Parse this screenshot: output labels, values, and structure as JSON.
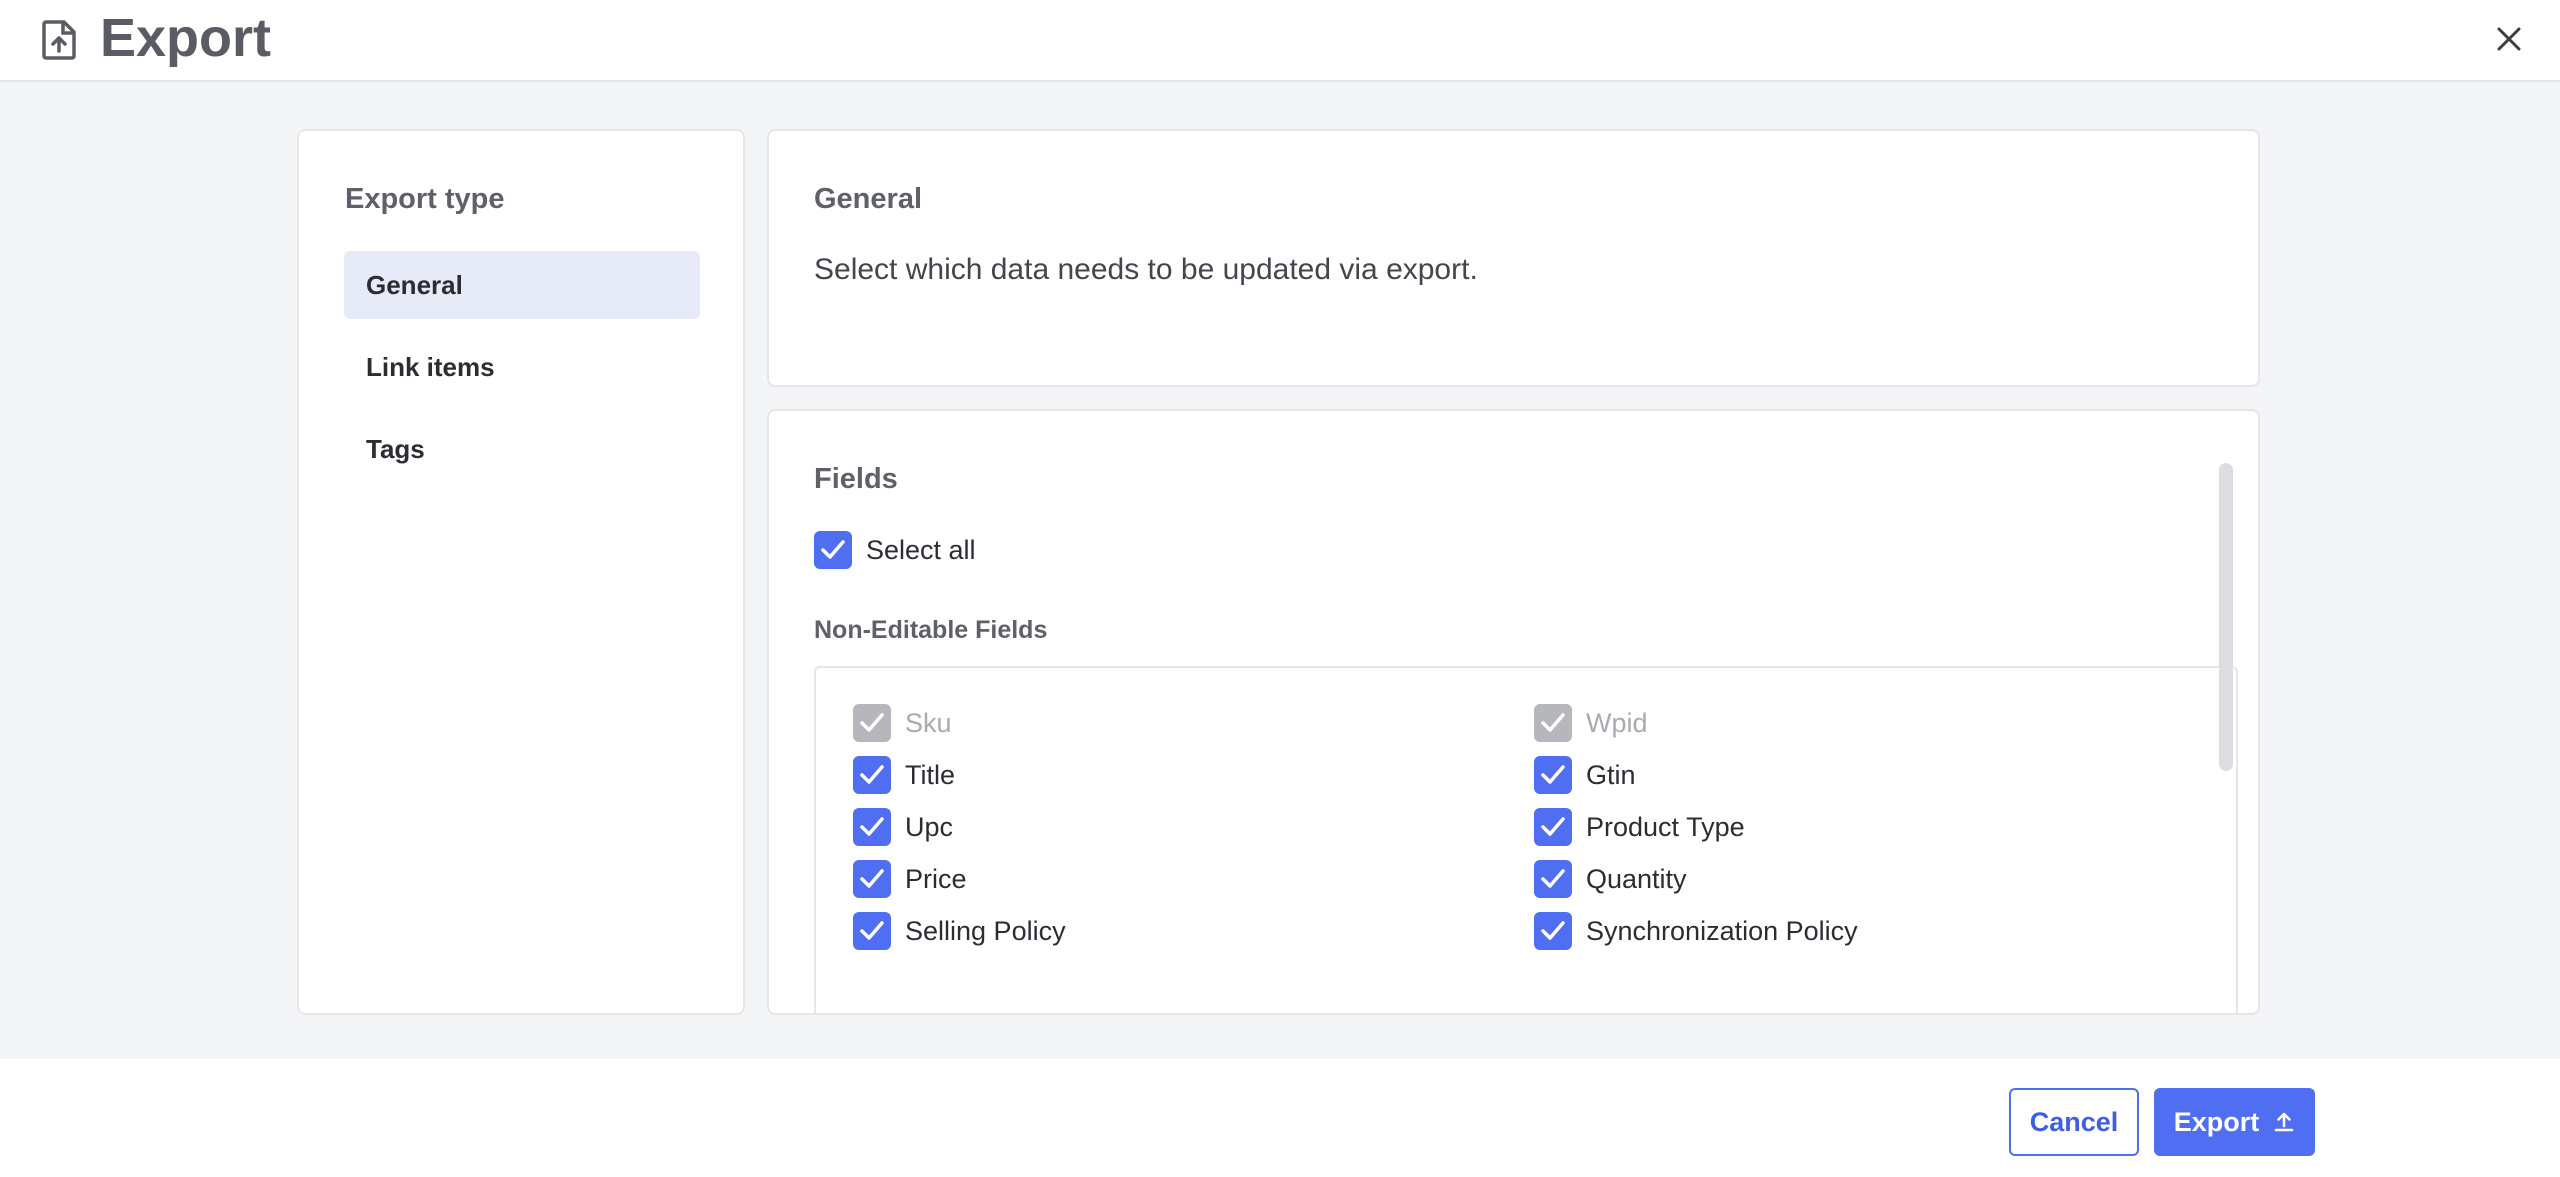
{
  "header": {
    "title": "Export",
    "icon": "file-export-icon",
    "close_icon": "close-icon"
  },
  "sidebar": {
    "title": "Export type",
    "items": [
      {
        "label": "General",
        "active": true
      },
      {
        "label": "Link items",
        "active": false
      },
      {
        "label": "Tags",
        "active": false
      }
    ]
  },
  "general": {
    "heading": "General",
    "description": "Select which data needs to be updated via export."
  },
  "fields": {
    "heading": "Fields",
    "select_all": {
      "label": "Select all",
      "checked": true
    },
    "non_editable_label": "Non-Editable Fields",
    "items": [
      {
        "label": "Sku",
        "checked": true,
        "disabled": true
      },
      {
        "label": "Wpid",
        "checked": true,
        "disabled": true
      },
      {
        "label": "Title",
        "checked": true,
        "disabled": false
      },
      {
        "label": "Gtin",
        "checked": true,
        "disabled": false
      },
      {
        "label": "Upc",
        "checked": true,
        "disabled": false
      },
      {
        "label": "Product Type",
        "checked": true,
        "disabled": false
      },
      {
        "label": "Price",
        "checked": true,
        "disabled": false
      },
      {
        "label": "Quantity",
        "checked": true,
        "disabled": false
      },
      {
        "label": "Selling Policy",
        "checked": true,
        "disabled": false
      },
      {
        "label": "Synchronization Policy",
        "checked": true,
        "disabled": false
      }
    ]
  },
  "footer": {
    "cancel_label": "Cancel",
    "export_label": "Export",
    "export_icon": "upload-icon"
  },
  "colors": {
    "accent": "#4f6ef2",
    "active_nav_bg": "#e7ebf8",
    "disabled_checkbox": "#b5b7bc"
  }
}
